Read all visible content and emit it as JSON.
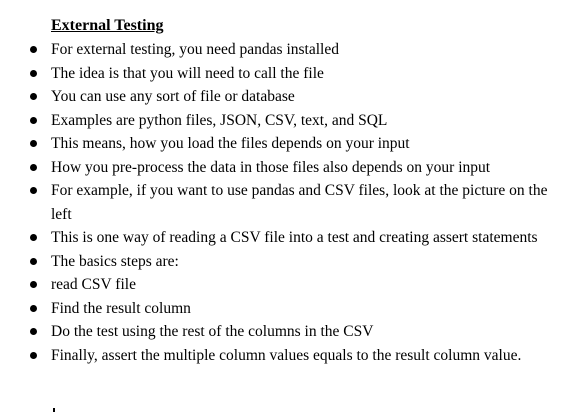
{
  "document": {
    "heading": "External Testing",
    "bullets": [
      "For external testing, you need pandas installed",
      "The idea is that you will need to call the file",
      "You can use any sort of file or database",
      "Examples are python files, JSON, CSV, text, and SQL",
      "This means, how you load the files depends on your input",
      "How you pre-process the data in those files also depends on your input",
      "For example, if you want to use pandas and CSV files, look at the picture on the left",
      "This is one way of reading a CSV file into a test and creating assert statements",
      "The basics steps are:",
      "read CSV file",
      "Find the result column",
      "Do the test using the rest of the columns in the CSV",
      "Finally, assert the multiple column values equals to the result column value."
    ]
  }
}
